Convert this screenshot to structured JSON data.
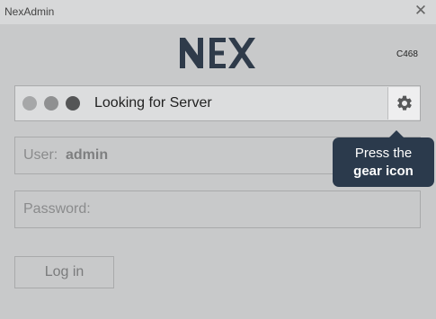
{
  "window": {
    "title": "NexAdmin",
    "close_glyph": "✕"
  },
  "brand": {
    "logo_alt": "NEX",
    "code": "C468"
  },
  "status": {
    "text": "Looking for Server",
    "settings_icon": "gear-icon"
  },
  "tooltip": {
    "line1": "Press the",
    "line2": "gear icon"
  },
  "login": {
    "user_label": "User:",
    "user_value": "admin",
    "password_label": "Password:",
    "login_button": "Log in"
  },
  "colors": {
    "background": "#c8c9ca",
    "tooltip_bg": "#2b3a4c",
    "logo": "#2f3b4a"
  }
}
